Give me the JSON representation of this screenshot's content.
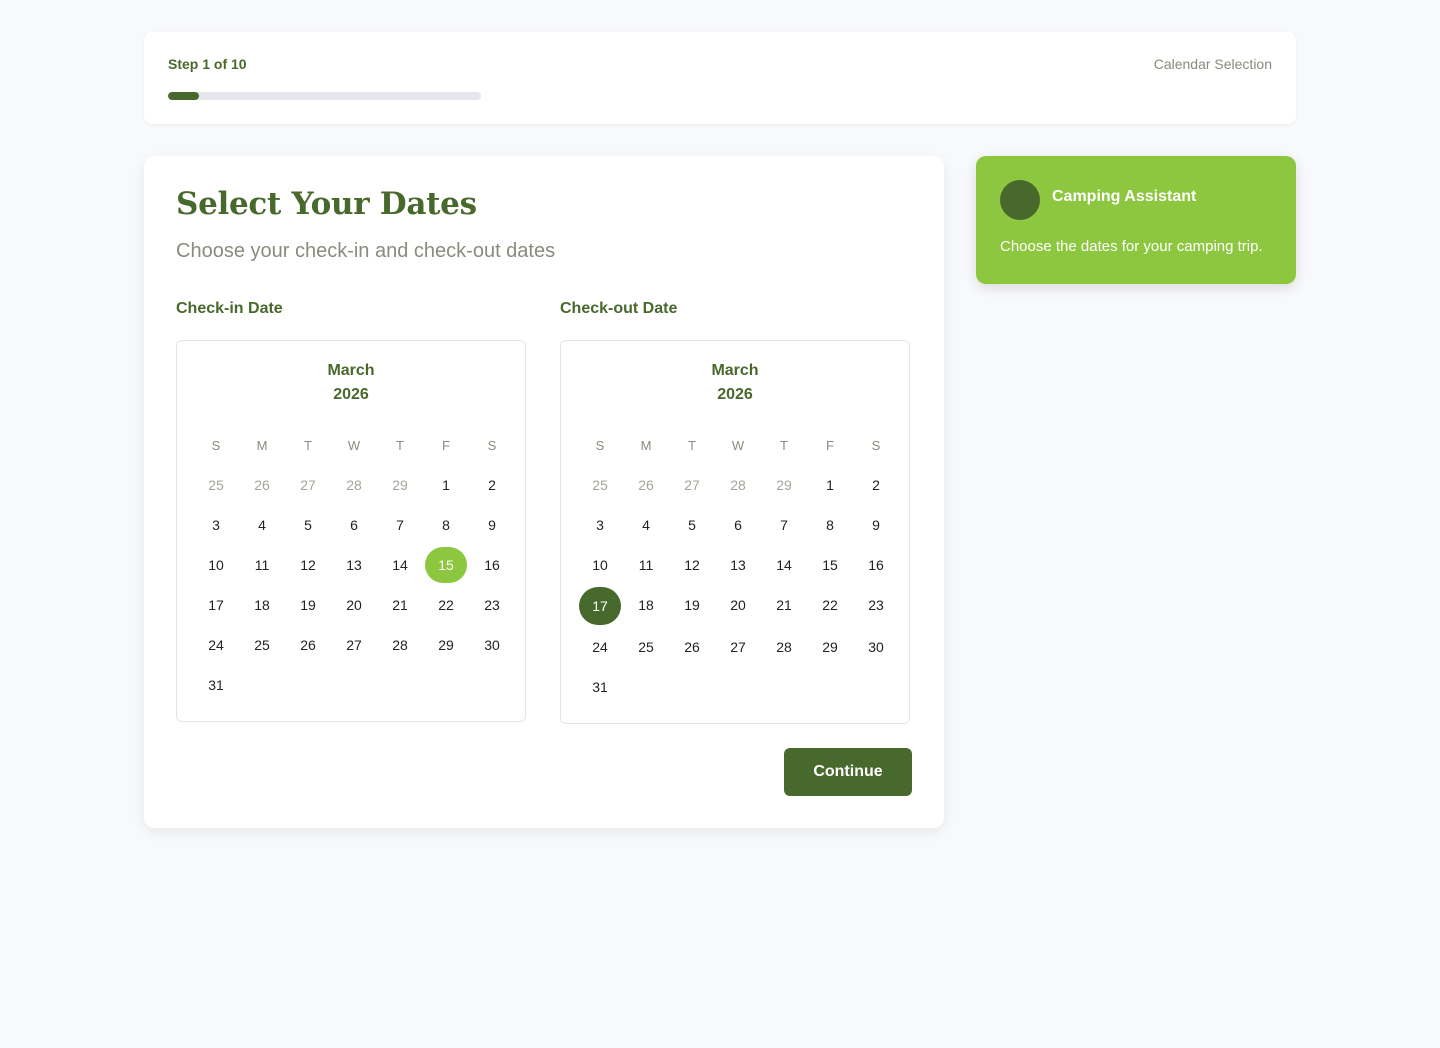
{
  "progress": {
    "step_label": "Step 1 of 10",
    "step_name": "Calendar Selection",
    "fraction": 0.1
  },
  "page": {
    "title": "Select Your Dates",
    "subtitle": "Choose your check-in and check-out dates"
  },
  "weekdays": [
    "S",
    "M",
    "T",
    "W",
    "T",
    "F",
    "S"
  ],
  "checkin": {
    "label": "Check-in Date",
    "month": "March",
    "year": "2026",
    "days": [
      "25",
      "26",
      "27",
      "28",
      "29",
      "1",
      "2",
      "3",
      "4",
      "5",
      "6",
      "7",
      "8",
      "9",
      "10",
      "11",
      "12",
      "13",
      "14",
      "15",
      "16",
      "17",
      "18",
      "19",
      "20",
      "21",
      "22",
      "23",
      "24",
      "25",
      "26",
      "27",
      "28",
      "29",
      "30",
      "31"
    ],
    "outside_count": 5,
    "selected": "15"
  },
  "checkout": {
    "label": "Check-out Date",
    "month": "March",
    "year": "2026",
    "days": [
      "25",
      "26",
      "27",
      "28",
      "29",
      "1",
      "2",
      "3",
      "4",
      "5",
      "6",
      "7",
      "8",
      "9",
      "10",
      "11",
      "12",
      "13",
      "14",
      "15",
      "16",
      "17",
      "18",
      "19",
      "20",
      "21",
      "22",
      "23",
      "24",
      "25",
      "26",
      "27",
      "28",
      "29",
      "30",
      "31"
    ],
    "outside_count": 5,
    "selected": "17"
  },
  "actions": {
    "continue_label": "Continue"
  },
  "assistant": {
    "name": "Camping Assistant",
    "message": "Choose the dates for your camping trip."
  },
  "colors": {
    "primary": "#48692c",
    "accent": "#8dc63f",
    "muted_text": "#8a8b7e"
  }
}
